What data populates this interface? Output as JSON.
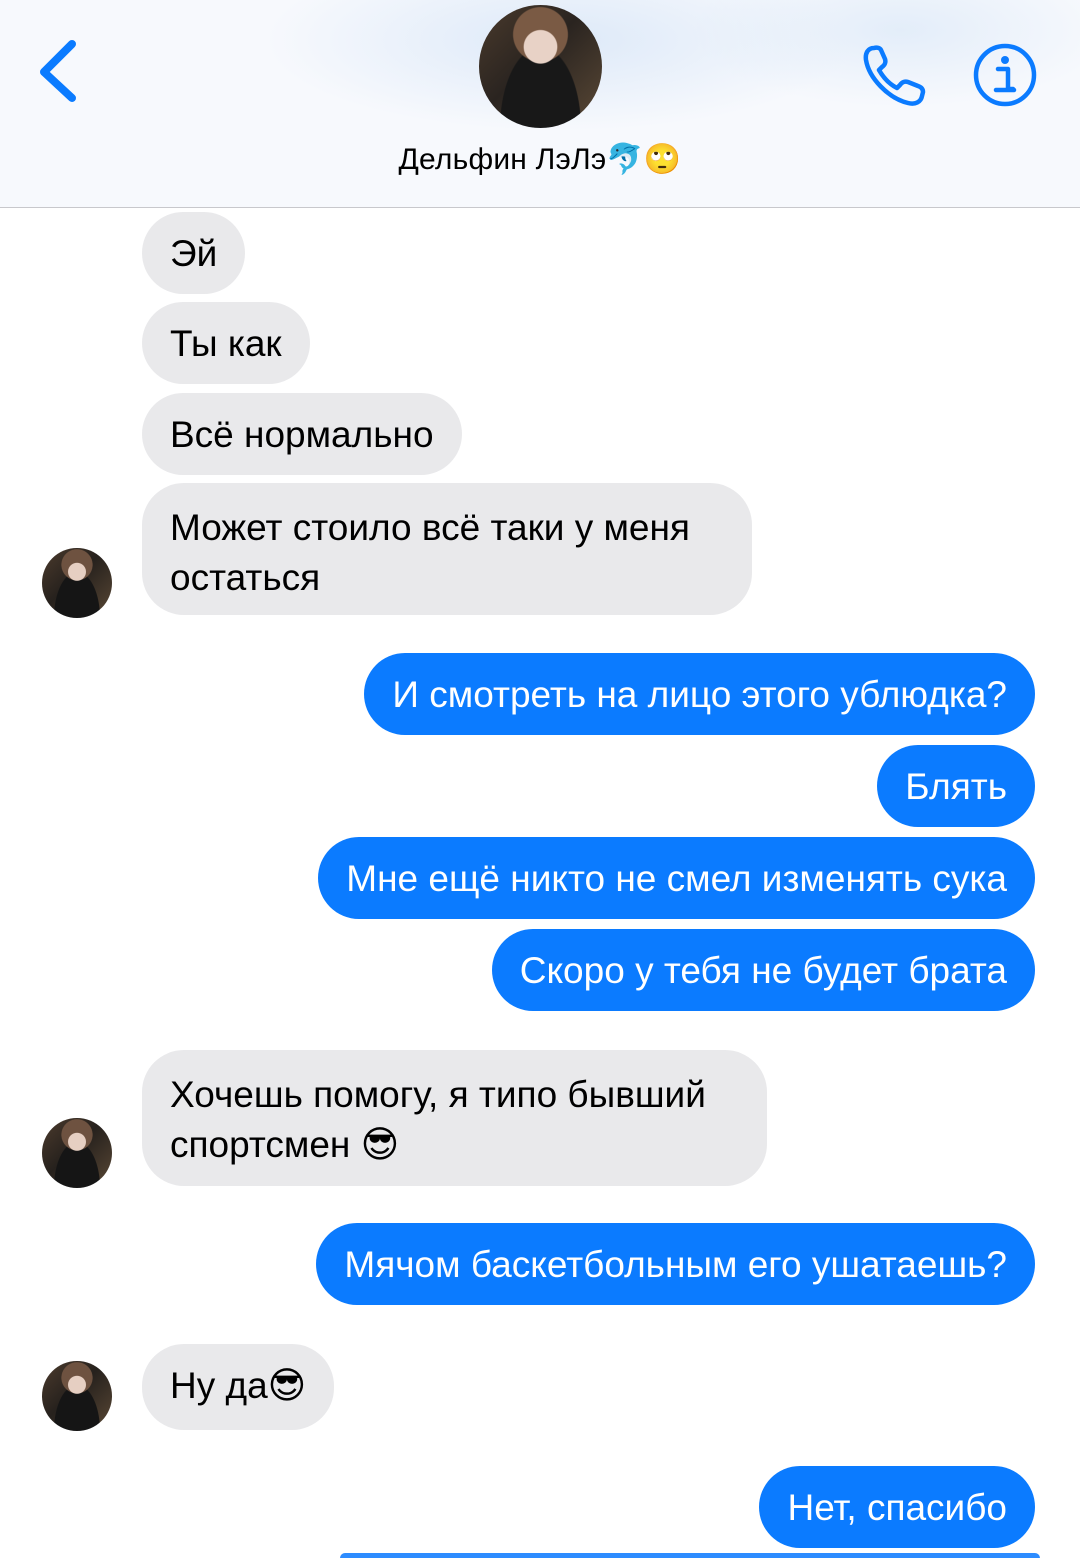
{
  "header": {
    "contact_name": "Дельфин ЛэЛэ",
    "contact_emoji": "🐬🙄",
    "icons": {
      "back": "chevron-left-icon",
      "call": "phone-icon",
      "info": "info-icon"
    },
    "accent_color": "#0b7bff"
  },
  "messages": [
    {
      "direction": "in",
      "text": "Эй"
    },
    {
      "direction": "in",
      "text": "Ты как"
    },
    {
      "direction": "in",
      "text": "Всё нормально"
    },
    {
      "direction": "in",
      "text": "Может стоило всё таки у меня остаться"
    },
    {
      "direction": "out",
      "text": "И смотреть на лицо этого ублюдка?"
    },
    {
      "direction": "out",
      "text": "Блять"
    },
    {
      "direction": "out",
      "text": "Мне ещё никто не смел изменять сука"
    },
    {
      "direction": "out",
      "text": "Скоро у тебя не будет брата"
    },
    {
      "direction": "in",
      "text": "Хочешь помогу, я типо бывший спортсмен",
      "emoji": "😎"
    },
    {
      "direction": "out",
      "text": "Мячом баскетбольным его ушатаешь?"
    },
    {
      "direction": "in",
      "text": "Ну да",
      "emoji": "😎"
    },
    {
      "direction": "out",
      "text": "Нет, спасибо"
    }
  ],
  "colors": {
    "incoming_bubble": "#e9e9eb",
    "outgoing_bubble": "#0b7bff"
  }
}
